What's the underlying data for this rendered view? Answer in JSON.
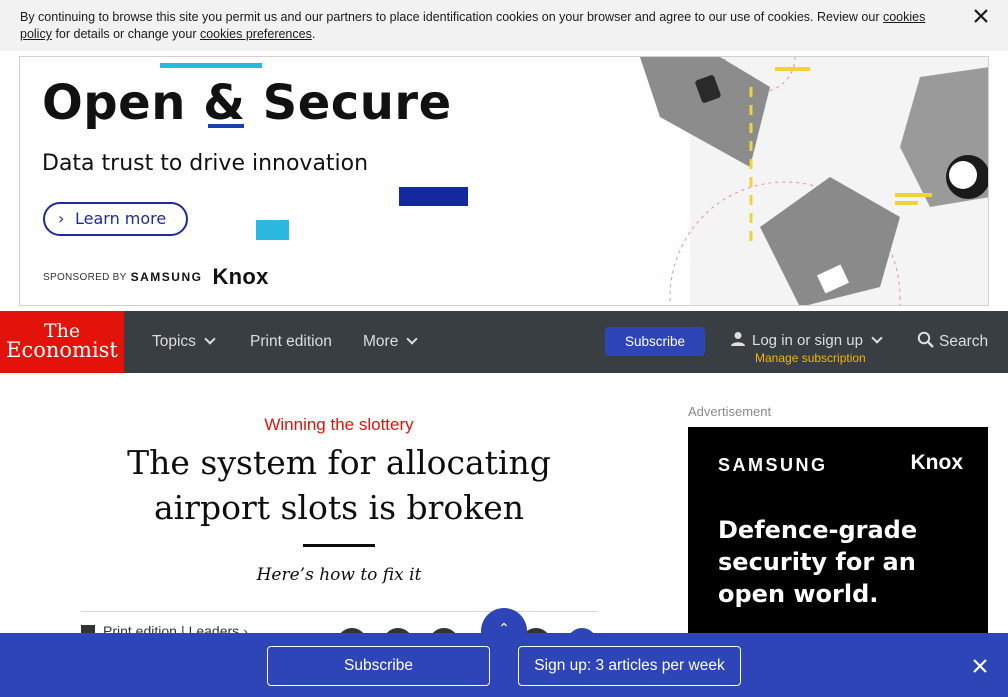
{
  "cookie_banner": {
    "text_before_link1": "By continuing to browse this site you permit us and our partners to place identification cookies on your browser and agree to our use of cookies. Review our ",
    "link1": "cookies policy",
    "text_between": " for details or change your ",
    "link2": "cookies preferences",
    "text_after": ".",
    "close_icon": "close-icon"
  },
  "top_ad": {
    "headline": "Open & Secure",
    "subheadline": "Data trust to drive innovation",
    "cta": "Learn more",
    "sponsored_by": "SPONSORED BY",
    "brand": "SAMSUNG",
    "product": "Knox",
    "colors": {
      "blue": "#1428a0",
      "cyan": "#2ab7e0"
    }
  },
  "header": {
    "logo_line1": "The",
    "logo_line2": "Economist",
    "nav": {
      "topics": "Topics",
      "print_edition": "Print edition",
      "more": "More"
    },
    "subscribe": "Subscribe",
    "login": "Log in or sign up",
    "manage": "Manage subscription",
    "search": "Search",
    "colors": {
      "brand_red": "#e3120b",
      "nav_bg": "#383e42",
      "accent_blue": "#2e45b8",
      "manage_yellow": "#f2b705"
    }
  },
  "article": {
    "kicker": "Winning the slottery",
    "headline": "The system for allocating airport slots is broken",
    "dek": "Here’s how to fix it",
    "section": "Print edition",
    "separator": "|",
    "subsection": "Leaders",
    "back_to_top_icon": "chevron-up-icon"
  },
  "right_ad": {
    "label": "Advertisement",
    "brand": "SAMSUNG",
    "product": "Knox",
    "message": "Defence-grade security for an open world."
  },
  "bottom_bar": {
    "subscribe": "Subscribe",
    "signup": "Sign up: 3 articles per week",
    "close_icon": "close-icon"
  }
}
